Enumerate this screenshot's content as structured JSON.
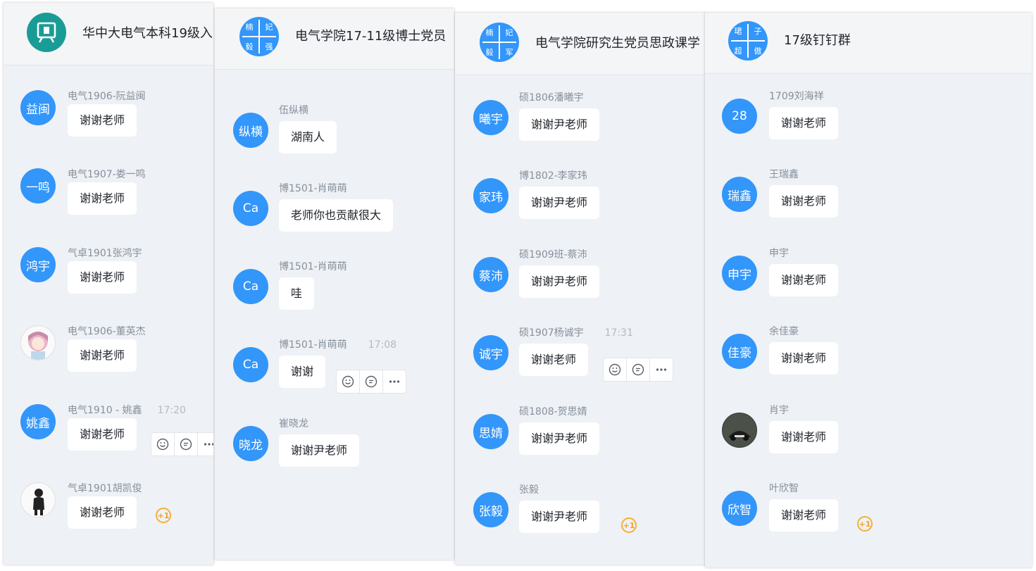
{
  "colors": {
    "avatar_blue": "#3296fa",
    "teal": "#1a9c96",
    "bubble": "#ffffff",
    "plus_one": "#f2b13a"
  },
  "panels": [
    {
      "group_title": "华中大电气本科19级入",
      "group_avatar": {
        "icon": "presentation-board-icon"
      },
      "messages": [
        {
          "avatar": "益闽",
          "sender": "电气1906-阮益闽",
          "text": "谢谢老师"
        },
        {
          "avatar": "一鸣",
          "sender": "电气1907-娄一鸣",
          "text": "谢谢老师"
        },
        {
          "avatar": "鸿宇",
          "sender": "气卓1901张鸿宇",
          "text": "谢谢老师"
        },
        {
          "avatar": "",
          "avatar_icon": "anime-girl-avatar-icon",
          "sender": "电气1906-董英杰",
          "text": "谢谢老师"
        },
        {
          "avatar": "姚鑫",
          "sender": "电气1910 - 姚鑫",
          "time": "17:20",
          "text": "谢谢老师"
        },
        {
          "avatar": "",
          "avatar_icon": "silhouette-avatar-icon",
          "sender": "气卓1901胡凯俊",
          "text": "谢谢老师",
          "plus": "+1"
        }
      ]
    },
    {
      "group_title": "电气学院17-11级博士党员",
      "group_avatar": {
        "quads": [
          "楠",
          "妃",
          "毅",
          "强"
        ]
      },
      "messages": [
        {
          "avatar": "纵横",
          "sender": "伍纵横",
          "text": "湖南人"
        },
        {
          "avatar": "Ca",
          "sender": "博1501-肖萌萌",
          "text": "老师你也贡献很大"
        },
        {
          "avatar": "Ca",
          "sender": "博1501-肖萌萌",
          "text": "哇"
        },
        {
          "avatar": "Ca",
          "sender": "博1501-肖萌萌",
          "time": "17:08",
          "text": "谢谢"
        },
        {
          "avatar": "晓龙",
          "sender": "崔晓龙",
          "text": "谢谢尹老师"
        }
      ]
    },
    {
      "group_title": "电气学院研究生党员思政课学",
      "group_avatar": {
        "quads": [
          "楠",
          "妃",
          "毅",
          "军"
        ]
      },
      "messages": [
        {
          "avatar": "曦宇",
          "sender": "硕1806潘曦宇",
          "text": "谢谢尹老师"
        },
        {
          "avatar": "家玮",
          "sender": "博1802-李家玮",
          "text": "谢谢尹老师"
        },
        {
          "avatar": "蔡沛",
          "sender": "硕1909班-蔡沛",
          "text": "谢谢尹老师"
        },
        {
          "avatar": "诚宇",
          "sender": "硕1907杨诚宇",
          "time": "17:31",
          "text": "谢谢老师"
        },
        {
          "avatar": "思婧",
          "sender": "硕1808-贺思婧",
          "text": "谢谢尹老师"
        },
        {
          "avatar": "张毅",
          "sender": "张毅",
          "text": "谢谢尹老师",
          "plus": "+1"
        }
      ]
    },
    {
      "group_title": "17级钉钉群",
      "group_avatar": {
        "quads": [
          "珺",
          "子",
          "超",
          "傲"
        ]
      },
      "messages": [
        {
          "avatar": "28",
          "sender": "1709刘海祥",
          "text": "谢谢老师"
        },
        {
          "avatar": "瑞鑫",
          "sender": "王瑞鑫",
          "text": "谢谢老师"
        },
        {
          "avatar": "申宇",
          "sender": "申宇",
          "text": "谢谢老师"
        },
        {
          "avatar": "佳豪",
          "sender": "余佳豪",
          "text": "谢谢老师"
        },
        {
          "avatar": "",
          "avatar_icon": "car-photo-avatar-icon",
          "sender": "肖宇",
          "text": "谢谢老师"
        },
        {
          "avatar": "欣智",
          "sender": "叶欣智",
          "text": "谢谢老师",
          "plus": "+1"
        }
      ]
    }
  ]
}
